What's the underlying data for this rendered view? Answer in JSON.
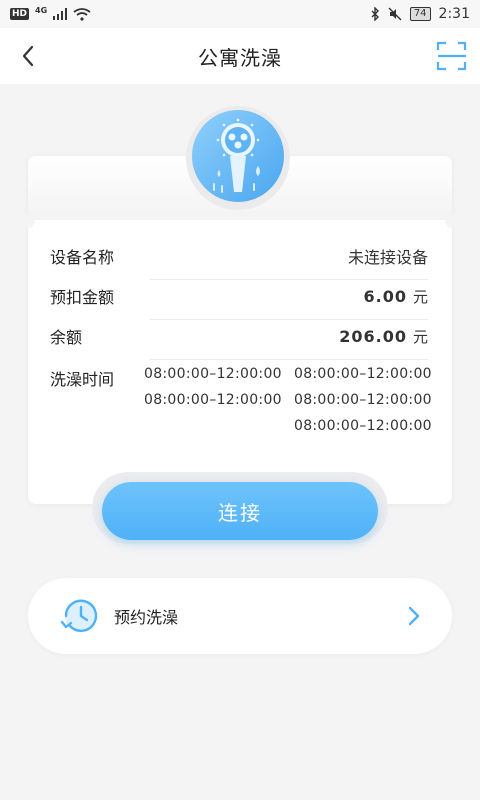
{
  "status_bar": {
    "hd": "HD",
    "network": "4G",
    "battery": "74",
    "time": "2:31"
  },
  "header": {
    "title": "公寓洗澡"
  },
  "device_card": {
    "rows": [
      {
        "label": "设备名称",
        "value": "未连接设备",
        "unit": ""
      },
      {
        "label": "预扣金额",
        "value": "6.00",
        "unit": "元"
      },
      {
        "label": "余额",
        "value": "206.00",
        "unit": "元"
      }
    ],
    "time_label": "洗澡时间",
    "time_slots": [
      "08:00:00–12:00:00",
      "08:00:00–12:00:00",
      "08:00:00–12:00:00",
      "08:00:00–12:00:00",
      "08:00:00–12:00:00"
    ]
  },
  "connect_button": {
    "label": "连接"
  },
  "reservation": {
    "label": "预约洗澡"
  },
  "colors": {
    "accent": "#4fb1f7",
    "background": "#f4f4f5"
  },
  "icons": {
    "back": "chevron-left-icon",
    "scan": "scan-icon",
    "shower": "shower-head-icon",
    "clock": "clock-icon",
    "arrow": "chevron-right-icon"
  }
}
